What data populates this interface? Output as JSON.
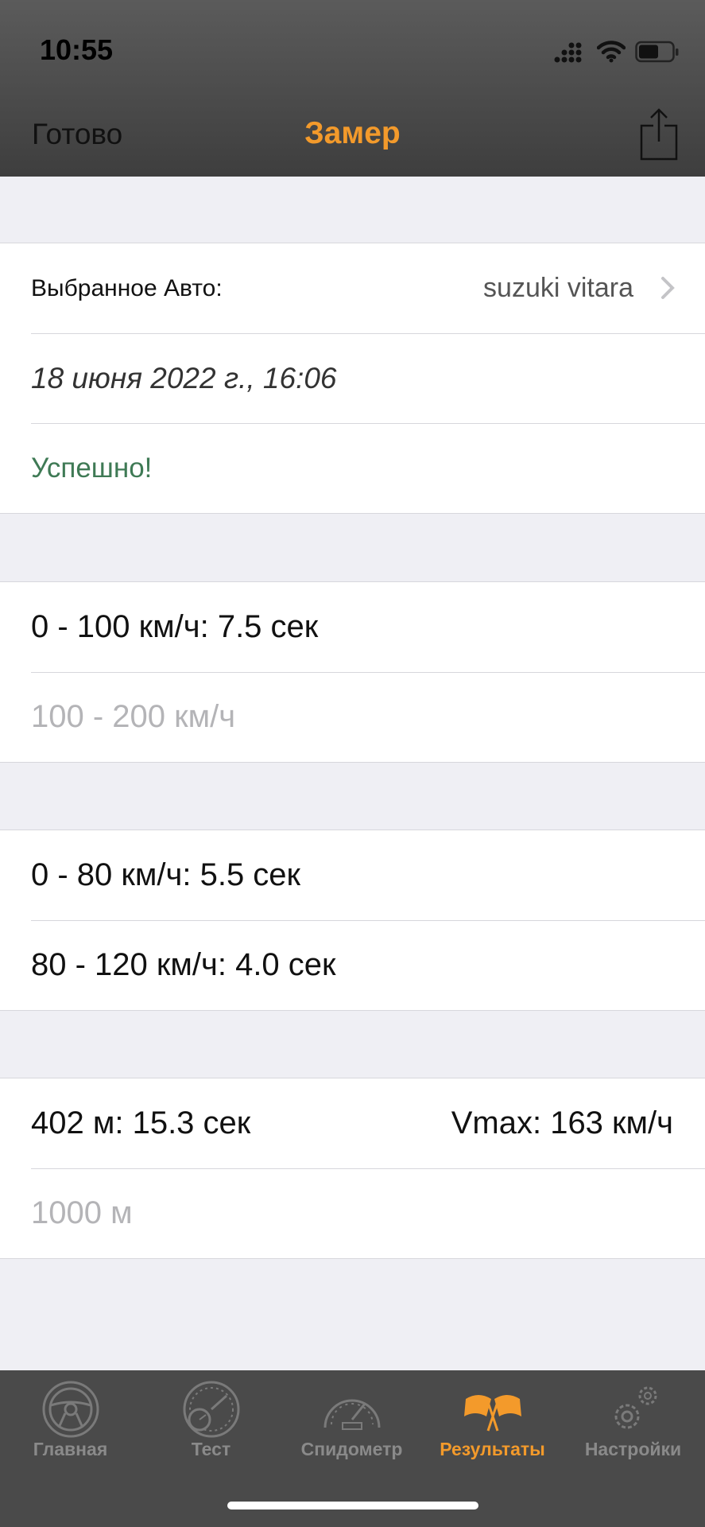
{
  "status_bar": {
    "time": "10:55"
  },
  "nav": {
    "done_label": "Готово",
    "title": "Замер"
  },
  "info": {
    "car_label": "Выбранное Авто:",
    "car_value": "suzuki vitara",
    "date": "18 июня 2022 г., 16:06",
    "status": "Успешно!"
  },
  "accel_group": {
    "row1": "0 - 100 км/ч: 7.5 сек",
    "row2": "100 - 200 км/ч"
  },
  "split_group": {
    "row1": "0 - 80 км/ч: 5.5 сек",
    "row2": "80 - 120 км/ч: 4.0 сек"
  },
  "distance_group": {
    "quarter_mile": "402 м: 15.3 сек",
    "vmax": "Vmax: 163 км/ч",
    "kilometer": "1000 м"
  },
  "tabbar": {
    "tabs": [
      {
        "label": "Главная",
        "icon": "steering-wheel-icon"
      },
      {
        "label": "Тест",
        "icon": "gauges-icon"
      },
      {
        "label": "Спидометр",
        "icon": "speedometer-icon"
      },
      {
        "label": "Результаты",
        "icon": "checkered-flags-icon"
      },
      {
        "label": "Настройки",
        "icon": "gears-icon"
      }
    ],
    "active_index": 3
  },
  "colors": {
    "accent": "#f39a2b",
    "success": "#3f7a55",
    "muted": "#b4b4b7"
  }
}
